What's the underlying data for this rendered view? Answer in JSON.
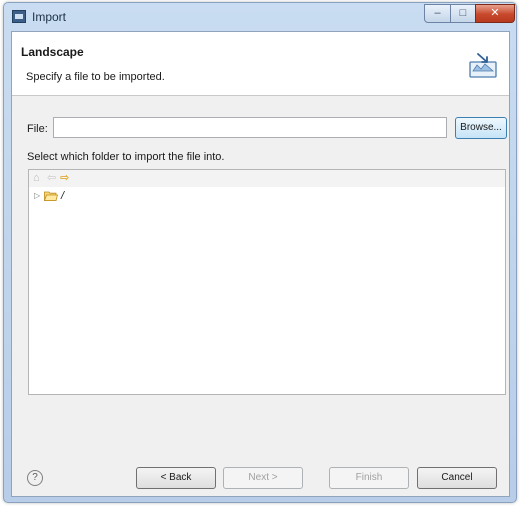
{
  "window": {
    "title": "Import",
    "controls": {
      "minimize": "–",
      "maximize": "□",
      "close": "✕"
    }
  },
  "header": {
    "title": "Landscape",
    "description": "Specify a file to be imported.",
    "icon": "import-wizard-icon"
  },
  "file": {
    "label": "File:",
    "value": "",
    "browse_label": "Browse..."
  },
  "instruction": "Select which folder to import the file into.",
  "tree": {
    "toolbar": {
      "home_icon": "home-icon",
      "back_icon": "back-arrow-icon",
      "forward_icon": "forward-arrow-icon"
    },
    "items": [
      {
        "label": "/",
        "icon": "folder-open-icon",
        "expander": "▷"
      }
    ]
  },
  "footer": {
    "help_icon": "?",
    "back_label": "< Back",
    "next_label": "Next >",
    "finish_label": "Finish",
    "cancel_label": "Cancel"
  },
  "colors": {
    "accent": "#3c7fb1",
    "folder": "#e3a21a",
    "close": "#c7482b"
  }
}
